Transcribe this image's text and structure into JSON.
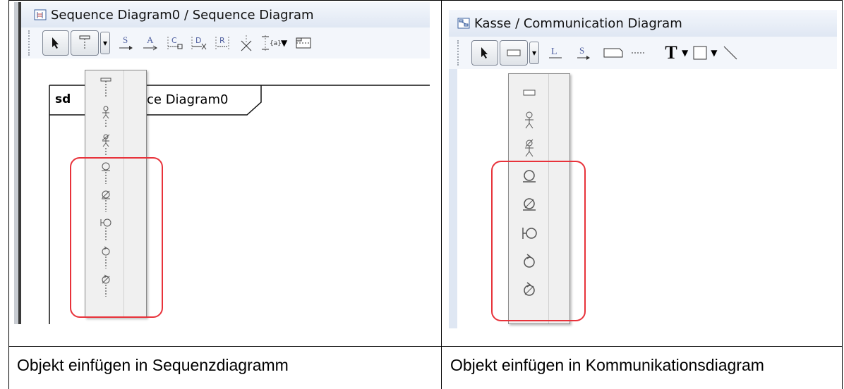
{
  "left": {
    "tab_title": "Sequence Diagram0 / Sequence Diagram",
    "frame_keyword": "sd",
    "frame_name": "ce Diagram0",
    "toolbar_letters": [
      "S",
      "A",
      "C",
      "D",
      "R"
    ],
    "popup_icons": [
      "lifeline-icon",
      "actor-lifeline-icon",
      "actor-instance-lifeline-icon",
      "boundary-lifeline-icon",
      "boundary-instance-lifeline-icon",
      "interface-lifeline-icon",
      "control-lifeline-icon",
      "control-instance-lifeline-icon"
    ]
  },
  "right": {
    "tab_title": "Kasse / Communication Diagram",
    "toolbar_letters": [
      "L",
      "S",
      "T"
    ],
    "popup_icons": [
      "object-icon",
      "actor-icon",
      "actor-instance-icon",
      "boundary-icon",
      "boundary-instance-icon",
      "interface-icon",
      "control-icon",
      "control-instance-icon"
    ]
  },
  "captions": {
    "left": "Objekt einfügen in Sequenzdiagramm",
    "right": "Objekt einfügen in Kommunikationsdiagram"
  },
  "colors": {
    "highlight": "#e8323a",
    "toolbar_bg": "#f3f6fb",
    "tab_gradient_end": "#dfe7f3"
  }
}
